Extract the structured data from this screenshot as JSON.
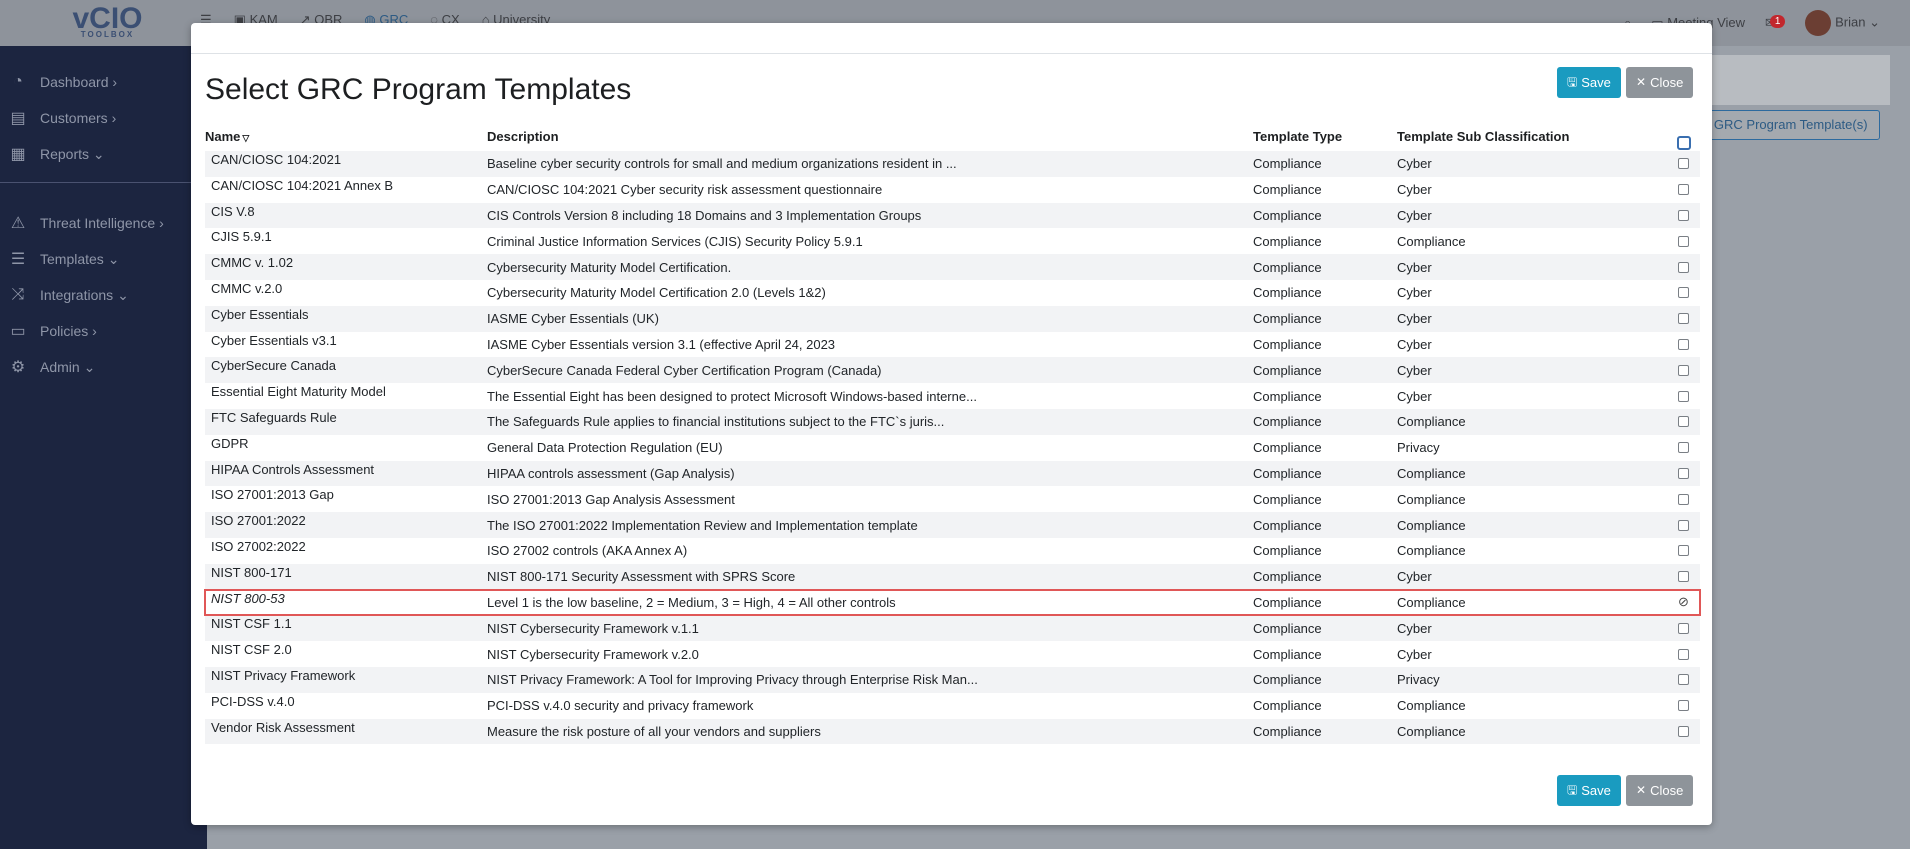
{
  "app": {
    "logo_text": "vCIO",
    "logo_sub": "TOOLBOX",
    "nav": [
      {
        "label": "KAM"
      },
      {
        "label": "QBR"
      },
      {
        "label": "GRC"
      },
      {
        "label": "CX"
      },
      {
        "label": "University"
      }
    ],
    "meeting_view": "Meeting View",
    "notifications_count": "1",
    "user_name": "Brian"
  },
  "sidebar": {
    "items": [
      {
        "label": "Dashboard",
        "icon": "gauge-icon",
        "glyph": "◔",
        "chevron": "›"
      },
      {
        "label": "Customers",
        "icon": "id-card-icon",
        "glyph": "▤",
        "chevron": "›"
      },
      {
        "label": "Reports",
        "icon": "report-icon",
        "glyph": "▦",
        "chevron": "⌄"
      },
      {
        "label": "Threat Intelligence",
        "icon": "warning-icon",
        "glyph": "⚠",
        "chevron": "›"
      },
      {
        "label": "Templates",
        "icon": "list-icon",
        "glyph": "☰",
        "chevron": "⌄"
      },
      {
        "label": "Integrations",
        "icon": "shuffle-icon",
        "glyph": "⤨",
        "chevron": "⌄"
      },
      {
        "label": "Policies",
        "icon": "document-icon",
        "glyph": "▭",
        "chevron": "›"
      },
      {
        "label": "Admin",
        "icon": "gears-icon",
        "glyph": "⚙",
        "chevron": "⌄"
      }
    ]
  },
  "background": {
    "add_button": "l GRC Program Template(s)"
  },
  "modal": {
    "title": "Select GRC Program Templates",
    "save_label": "Save",
    "close_label": "Close",
    "columns": {
      "name": "Name",
      "description": "Description",
      "type": "Template Type",
      "sub": "Template Sub Classification"
    },
    "rows": [
      {
        "name": "CAN/CIOSC 104:2021",
        "description": "Baseline cyber security controls for small and medium organizations resident in ...",
        "type": "Compliance",
        "sub": "Cyber"
      },
      {
        "name": "CAN/CIOSC 104:2021 Annex B",
        "description": "CAN/CIOSC 104:2021 Cyber security risk assessment questionnaire",
        "type": "Compliance",
        "sub": "Cyber"
      },
      {
        "name": "CIS V.8",
        "description": "CIS Controls Version 8 including 18 Domains and 3 Implementation Groups",
        "type": "Compliance",
        "sub": "Cyber"
      },
      {
        "name": "CJIS 5.9.1",
        "description": "Criminal Justice Information Services (CJIS) Security Policy 5.9.1",
        "type": "Compliance",
        "sub": "Compliance"
      },
      {
        "name": "CMMC v. 1.02",
        "description": "Cybersecurity Maturity Model Certification.",
        "type": "Compliance",
        "sub": "Cyber"
      },
      {
        "name": "CMMC v.2.0",
        "description": "Cybersecurity Maturity Model Certification 2.0 (Levels 1&2)",
        "type": "Compliance",
        "sub": "Cyber"
      },
      {
        "name": "Cyber Essentials",
        "description": "IASME Cyber Essentials (UK)",
        "type": "Compliance",
        "sub": "Cyber"
      },
      {
        "name": "Cyber Essentials v3.1",
        "description": "IASME Cyber Essentials version 3.1 (effective April 24, 2023",
        "type": "Compliance",
        "sub": "Cyber"
      },
      {
        "name": "CyberSecure Canada",
        "description": "CyberSecure Canada Federal Cyber Certification Program (Canada)",
        "type": "Compliance",
        "sub": "Cyber"
      },
      {
        "name": "Essential Eight Maturity Model",
        "description": "The Essential Eight has been designed to protect Microsoft Windows-based interne...",
        "type": "Compliance",
        "sub": "Cyber"
      },
      {
        "name": "FTC Safeguards Rule",
        "description": "The Safeguards Rule applies to financial institutions subject to the FTC`s juris...",
        "type": "Compliance",
        "sub": "Compliance"
      },
      {
        "name": "GDPR",
        "description": "General Data Protection Regulation (EU)",
        "type": "Compliance",
        "sub": "Privacy"
      },
      {
        "name": "HIPAA Controls Assessment",
        "description": "HIPAA controls assessment (Gap Analysis)",
        "type": "Compliance",
        "sub": "Compliance"
      },
      {
        "name": "ISO 27001:2013 Gap",
        "description": "ISO 27001:2013 Gap Analysis Assessment",
        "type": "Compliance",
        "sub": "Compliance"
      },
      {
        "name": "ISO 27001:2022",
        "description": "The ISO 27001:2022 Implementation Review and Implementation template",
        "type": "Compliance",
        "sub": "Compliance"
      },
      {
        "name": "ISO 27002:2022",
        "description": "ISO 27002 controls (AKA Annex A)",
        "type": "Compliance",
        "sub": "Compliance"
      },
      {
        "name": "NIST 800-171",
        "description": "NIST 800-171 Security Assessment with SPRS Score",
        "type": "Compliance",
        "sub": "Cyber"
      },
      {
        "name": "NIST 800-53",
        "description": "Level 1 is the low baseline, 2 = Medium, 3 = High, 4 = All other controls",
        "type": "Compliance",
        "sub": "Compliance",
        "selected": true
      },
      {
        "name": "NIST CSF 1.1",
        "description": "NIST Cybersecurity Framework v.1.1",
        "type": "Compliance",
        "sub": "Cyber"
      },
      {
        "name": "NIST CSF 2.0",
        "description": "NIST Cybersecurity Framework v.2.0",
        "type": "Compliance",
        "sub": "Cyber"
      },
      {
        "name": "NIST Privacy Framework",
        "description": "NIST Privacy Framework: A Tool for Improving Privacy through Enterprise Risk Man...",
        "type": "Compliance",
        "sub": "Privacy"
      },
      {
        "name": "PCI-DSS v.4.0",
        "description": "PCI-DSS v.4.0 security and privacy framework",
        "type": "Compliance",
        "sub": "Compliance"
      },
      {
        "name": "Vendor Risk Assessment",
        "description": "Measure the risk posture of all your vendors and suppliers",
        "type": "Compliance",
        "sub": "Compliance"
      }
    ]
  }
}
